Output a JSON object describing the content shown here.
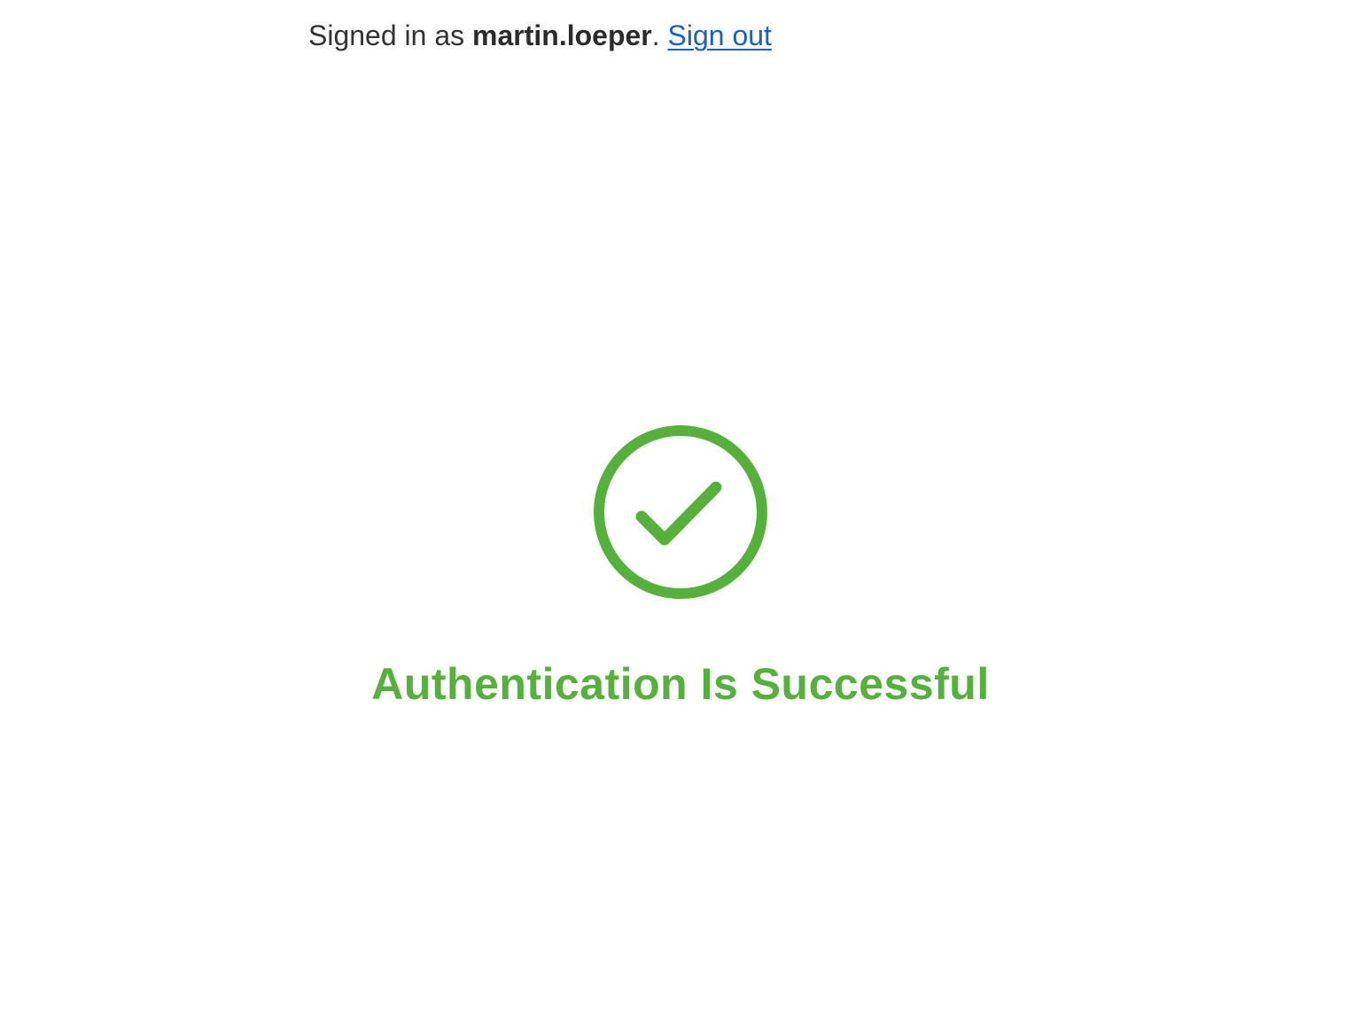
{
  "header": {
    "signed_in_prefix": "Signed in as",
    "username": "martin.loeper",
    "period": ".",
    "sign_out_label": "Sign out"
  },
  "status": {
    "icon": "check-circle-icon",
    "title": "Authentication Is Successful",
    "color": "#55b13c"
  },
  "colors": {
    "link": "#1f5fbf",
    "text": "#333333",
    "success": "#55b13c"
  }
}
